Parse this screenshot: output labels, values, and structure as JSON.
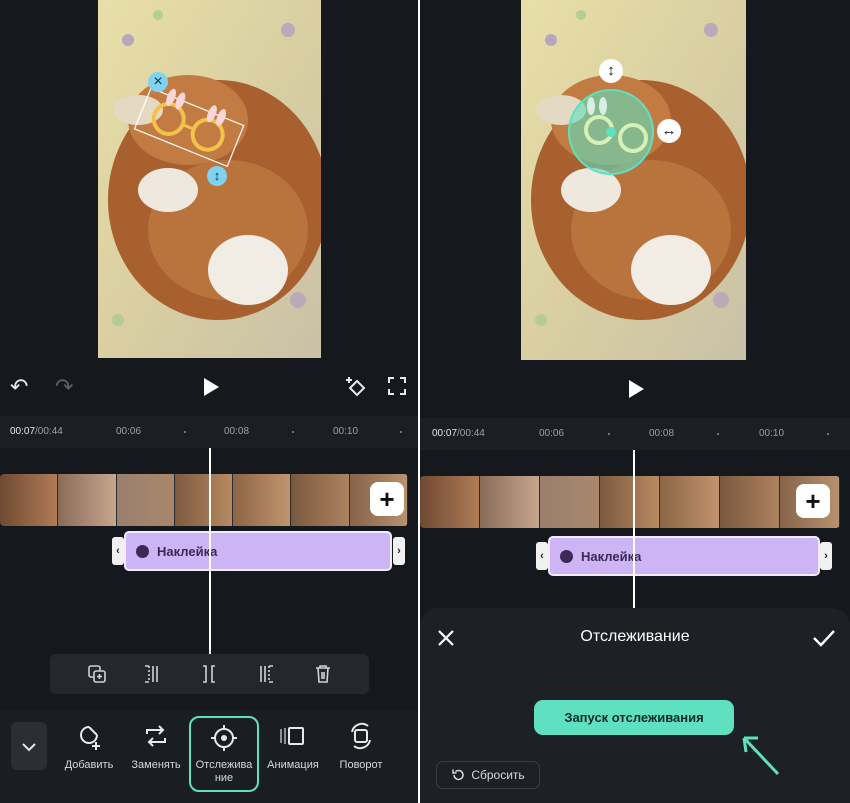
{
  "left": {
    "time_current": "00:07",
    "time_total": "/00:44",
    "ticks": [
      "00:06",
      "00:08",
      "00:10"
    ],
    "sticker_label": "Наклейка",
    "bottom_items": [
      {
        "label": "Добавить",
        "icon": "add-sticker-icon"
      },
      {
        "label": "Заменять",
        "icon": "replace-icon"
      },
      {
        "label": "Отслежива ние",
        "icon": "tracking-icon",
        "active": true
      },
      {
        "label": "Анимация",
        "icon": "animation-icon"
      },
      {
        "label": "Поворот",
        "icon": "rotate-icon"
      }
    ]
  },
  "right": {
    "time_current": "00:07",
    "time_total": "/00:44",
    "ticks": [
      "00:06",
      "00:08",
      "00:10"
    ],
    "sticker_label": "Наклейка",
    "sheet": {
      "title": "Отслеживание",
      "start_button": "Запуск отслеживания",
      "reset_button": "Сбросить"
    }
  },
  "colors": {
    "accent": "#5fe0c0",
    "sticker_clip": "#cdb4f4",
    "background": "#15181c"
  }
}
